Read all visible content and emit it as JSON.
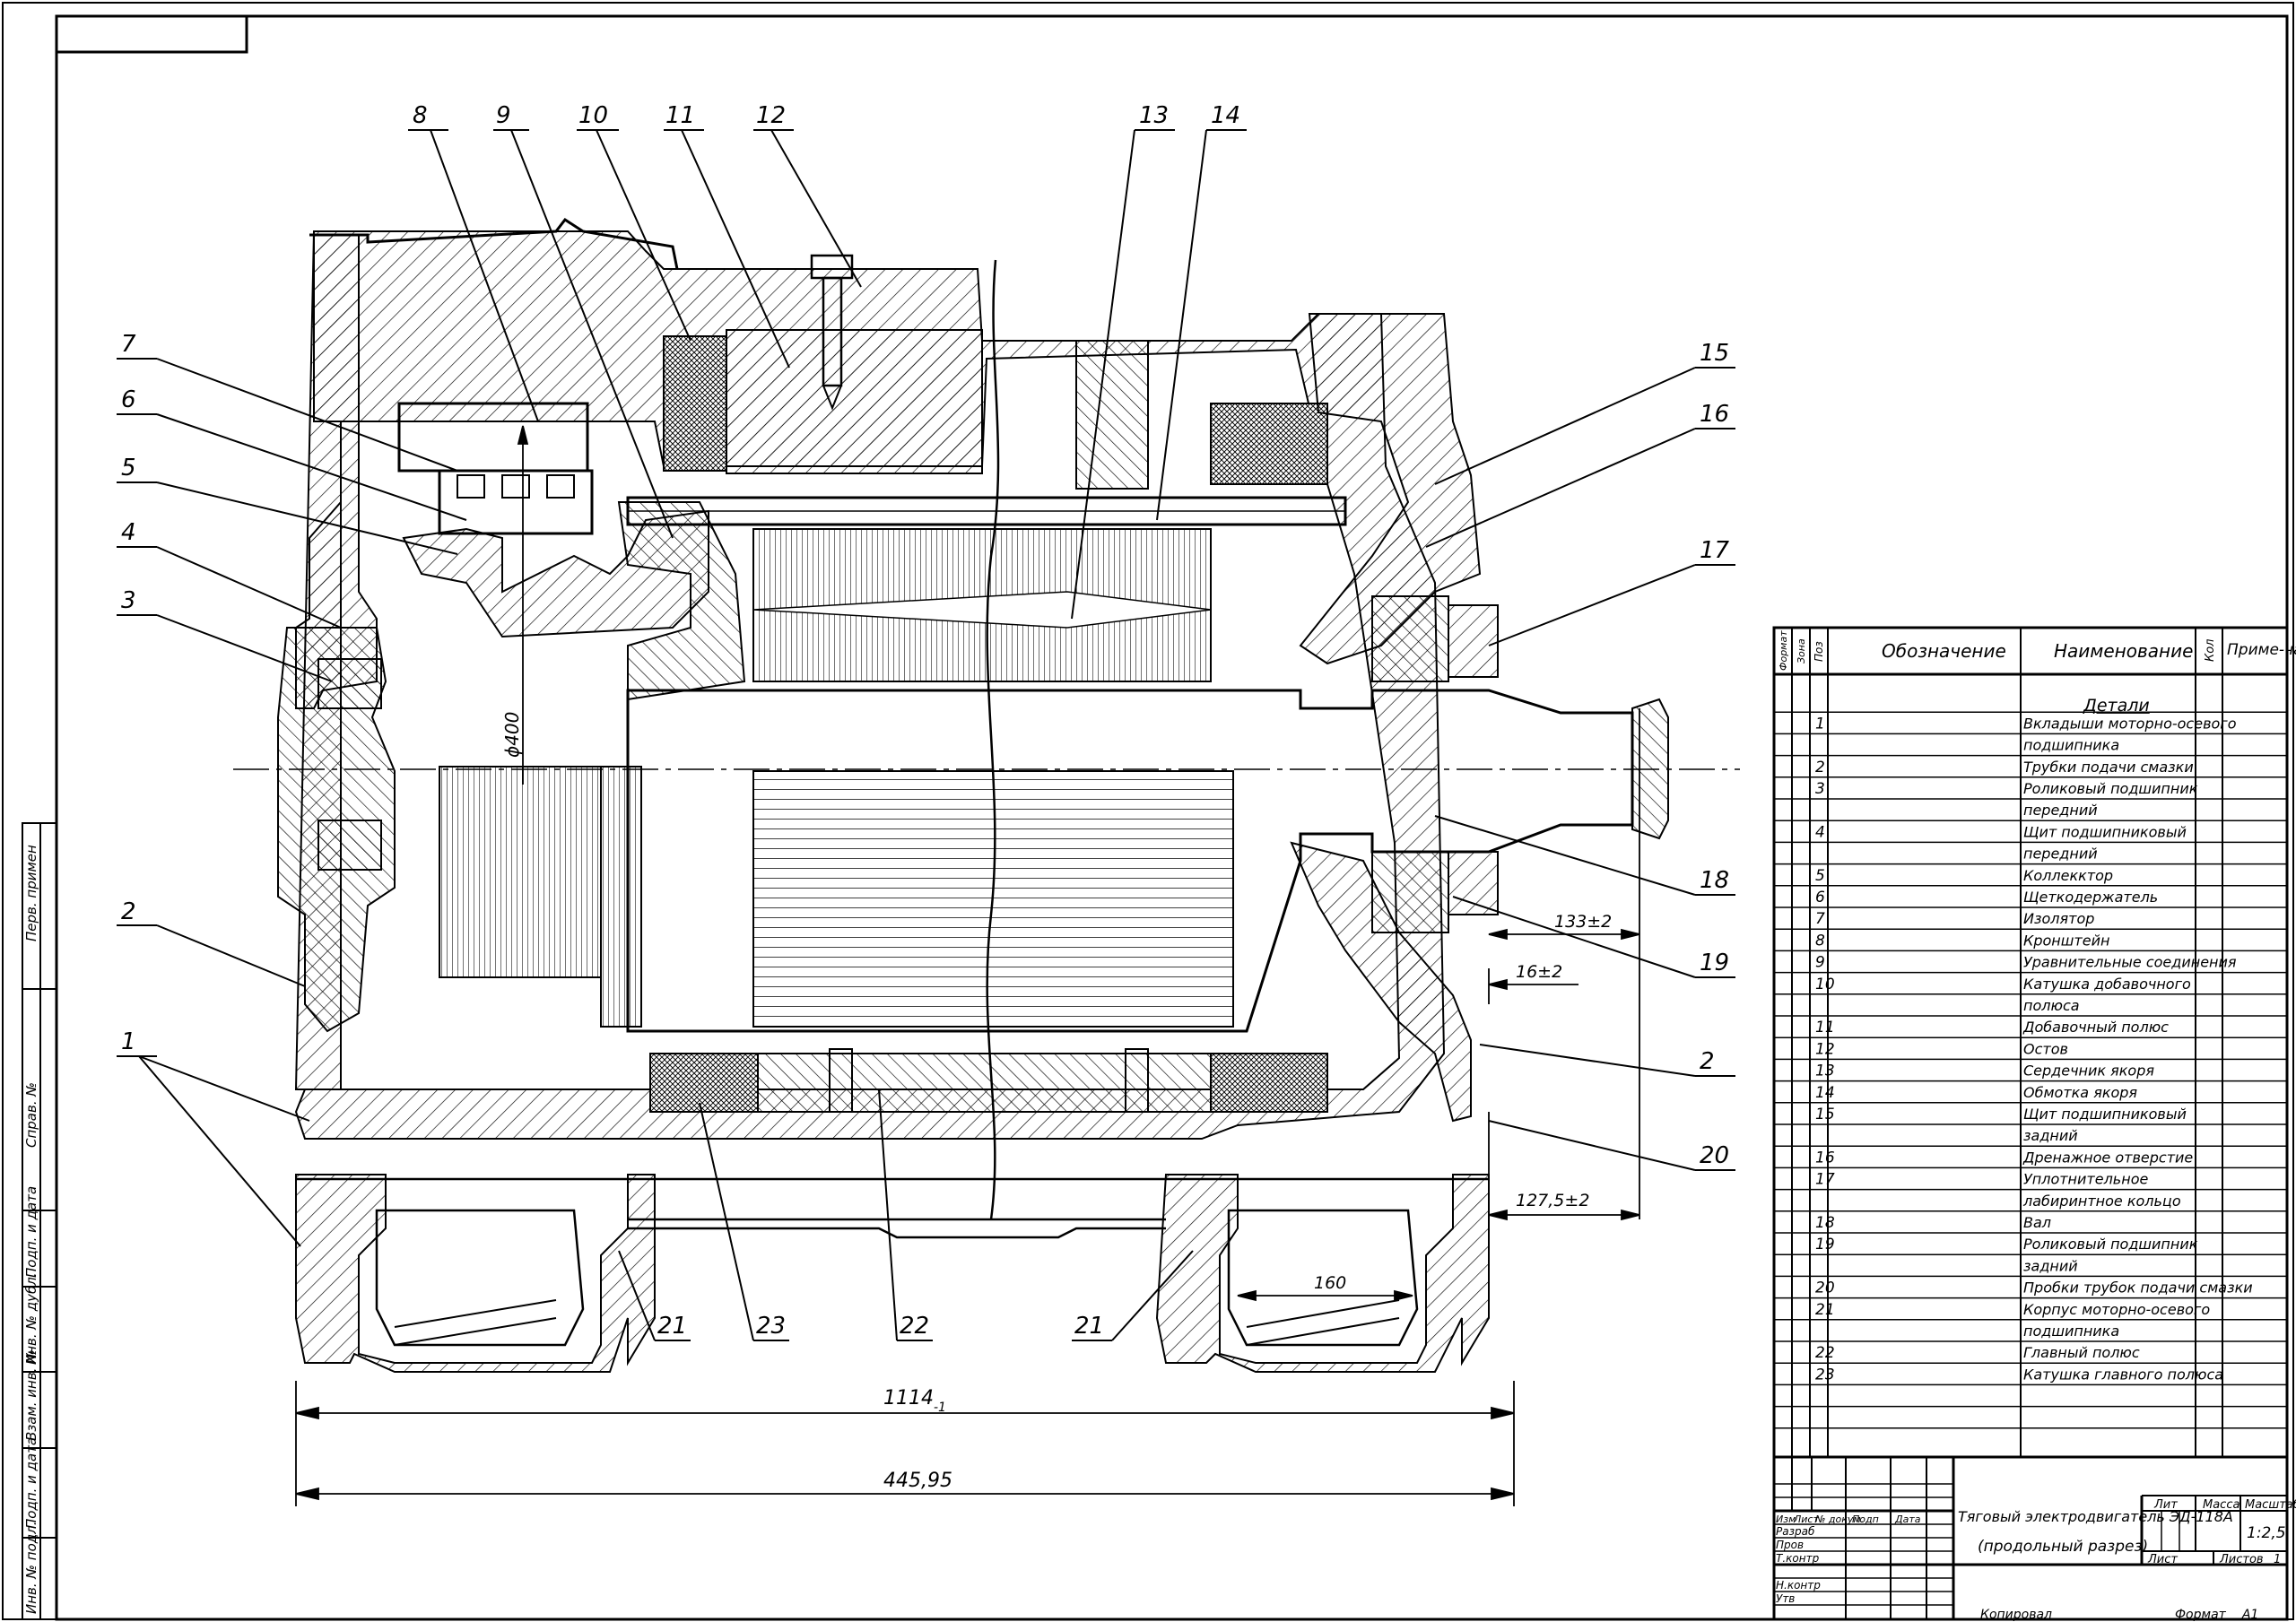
{
  "callouts": [
    {
      "label": "1"
    },
    {
      "label": "2"
    },
    {
      "label": "3"
    },
    {
      "label": "4"
    },
    {
      "label": "5"
    },
    {
      "label": "6"
    },
    {
      "label": "7"
    },
    {
      "label": "8"
    },
    {
      "label": "9"
    },
    {
      "label": "10"
    },
    {
      "label": "11"
    },
    {
      "label": "12"
    },
    {
      "label": "13"
    },
    {
      "label": "14"
    },
    {
      "label": "15"
    },
    {
      "label": "16"
    },
    {
      "label": "17"
    },
    {
      "label": "18"
    },
    {
      "label": "19"
    },
    {
      "label": "2"
    },
    {
      "label": "20"
    },
    {
      "label": "21"
    },
    {
      "label": "23"
    },
    {
      "label": "22"
    },
    {
      "label": "21"
    }
  ],
  "dimensions": {
    "overall_length": "1114",
    "overall_length_tol": "-1",
    "total": "445,95",
    "d133": "133±2",
    "d16": "16±2",
    "d127": "127,5±2",
    "d160": "160",
    "phi400": "ϕ400"
  },
  "spec_table": {
    "headers": {
      "format": "Формат",
      "zone": "Зона",
      "pos": "Поз",
      "designation": "Обозначение",
      "name": "Наименование",
      "qty": "Кол",
      "note": "Приме-чание"
    },
    "section": "Детали",
    "rows": [
      {
        "pos": "1",
        "name": "Вкладыши моторно-осевого"
      },
      {
        "pos": "",
        "name": "подшипника"
      },
      {
        "pos": "2",
        "name": "Трубки подачи смазки"
      },
      {
        "pos": "3",
        "name": "Роликовый подшипник"
      },
      {
        "pos": "",
        "name": "передний"
      },
      {
        "pos": "4",
        "name": "Щит подшипниковый"
      },
      {
        "pos": "",
        "name": "передний"
      },
      {
        "pos": "5",
        "name": "Коллекктор"
      },
      {
        "pos": "6",
        "name": "Щеткодержатель"
      },
      {
        "pos": "7",
        "name": "Изолятор"
      },
      {
        "pos": "8",
        "name": "Кронштейн"
      },
      {
        "pos": "9",
        "name": "Уравнительные соединения"
      },
      {
        "pos": "10",
        "name": "Катушка добавочного"
      },
      {
        "pos": "",
        "name": "полюса"
      },
      {
        "pos": "11",
        "name": "Добавочный полюс"
      },
      {
        "pos": "12",
        "name": "Остов"
      },
      {
        "pos": "13",
        "name": "Сердечник якоря"
      },
      {
        "pos": "14",
        "name": "Обмотка якоря"
      },
      {
        "pos": "15",
        "name": "Щит подшипниковый"
      },
      {
        "pos": "",
        "name": "задний"
      },
      {
        "pos": "16",
        "name": "Дренажное отверстие"
      },
      {
        "pos": "17",
        "name": "Уплотнительное"
      },
      {
        "pos": "",
        "name": "лабиринтное кольцо"
      },
      {
        "pos": "18",
        "name": "Вал"
      },
      {
        "pos": "19",
        "name": "Роликовый подшипник"
      },
      {
        "pos": "",
        "name": "задний"
      },
      {
        "pos": "20",
        "name": "Пробки трубок подачи смазки"
      },
      {
        "pos": "21",
        "name": "Корпус моторно-осевого"
      },
      {
        "pos": "",
        "name": "подшипника"
      },
      {
        "pos": "22",
        "name": "Главный полюс"
      },
      {
        "pos": "23",
        "name": "Катушка главного полюса"
      },
      {
        "pos": "",
        "name": ""
      },
      {
        "pos": "",
        "name": ""
      }
    ]
  },
  "title_block": {
    "title_line1": "Тяговый электродвигатель ЭД-118А",
    "title_line2": "(продольный разрез)",
    "cols": {
      "izm": "Изм",
      "list": "Лист",
      "doc": "№ докум.",
      "sign": "Подп",
      "date": "Дата"
    },
    "roles": [
      "Разраб",
      "Пров",
      "Т.контр",
      "",
      "Н.контр",
      "Утв"
    ],
    "lit": "Лит",
    "mass": "Масса",
    "scale_label": "Масштаб",
    "scale": "1:2,5",
    "sheet": "Лист",
    "sheets": "Листов",
    "sheets_count": "1",
    "copied": "Копировал",
    "format_label": "Формат",
    "format": "A1"
  },
  "side_stamps": [
    "Перв. примен",
    "Справ. №",
    "Подп. и дата",
    "Инв. № дубл.",
    "Взам. инв. №",
    "Подп. и дата",
    "Инв. № подл."
  ]
}
